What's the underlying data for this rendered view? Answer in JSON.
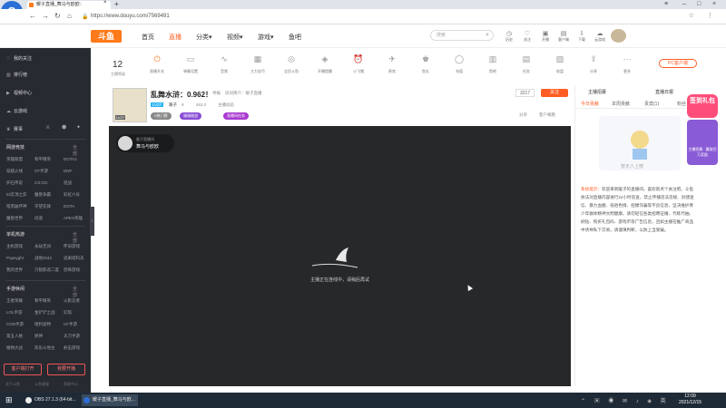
{
  "browser": {
    "tab_title": "暖子直播_舞马与欧欧：",
    "url": "https://www.douyu.com/7569491",
    "logo_letter": "S"
  },
  "header": {
    "brand": "斗鱼",
    "nav": [
      "首页",
      "直播",
      "分类",
      "视频",
      "游戏",
      "鱼吧"
    ],
    "search_placeholder": "搜索",
    "icons": [
      {
        "name": "history-icon",
        "label": "历史"
      },
      {
        "name": "follow-icon",
        "label": "关注"
      },
      {
        "name": "open-live-icon",
        "label": "开播"
      },
      {
        "name": "fish-bar-icon",
        "label": "客户端"
      },
      {
        "name": "download-icon",
        "label": "下载"
      },
      {
        "name": "cloud-icon",
        "label": "云游戏"
      },
      {
        "name": "mail-icon",
        "label": "任务中心"
      }
    ]
  },
  "sidebar": {
    "top_items": [
      {
        "icon": "heart-icon",
        "label": "我的关注"
      },
      {
        "icon": "rank-icon",
        "label": "排行榜"
      },
      {
        "icon": "video-icon",
        "label": "视频中心"
      },
      {
        "icon": "cloud-game-icon",
        "label": "云游戏"
      },
      {
        "icon": "match-icon",
        "label": "赛事"
      }
    ],
    "sections": [
      {
        "title": "网游竞技",
        "all": "全部",
        "items": [
          "英雄联盟",
          "和平精英",
          "DOTA2",
          "穿越火线",
          "CF手游",
          "DNF",
          "炉石传说",
          "CS:GO",
          "逆战",
          "lol云顶之弈",
          "魔兽争霸",
          "彩虹六号",
          "暗黑破坏神",
          "守望先锋",
          "DOTA",
          "魔兽世界",
          "问道",
          "APEX英雄"
        ]
      },
      {
        "title": "单机热游",
        "all": "全部",
        "items": [
          "主机游戏",
          "永劫无间",
          "怀旧游戏",
          "Popeyght",
          "战地2042",
          "逃离塔科夫",
          "我的世界",
          "只狼影逝二度",
          "恐怖游戏"
        ]
      },
      {
        "title": "手游休闲",
        "all": "全部",
        "items": [
          "王者荣耀",
          "和平精英",
          "火影忍者",
          "LOL手游",
          "金铲铲之战",
          "幻塔",
          "COD手游",
          "哈利波特",
          "CF手游",
          "第五人格",
          "原神",
          "天刀手游",
          "植物大战",
          "欢乐斗地主",
          "射击游戏"
        ]
      }
    ],
    "buttons": [
      "客户端打开",
      "我要开播"
    ],
    "footer": [
      "关于斗鱼",
      "斗鱼客服",
      "帮助中心"
    ]
  },
  "toolbar": {
    "level": "12",
    "level_label": "主播等级",
    "items": [
      "直播开关",
      "弹幕设置",
      "音频",
      "大力金币",
      "全民斗鱼",
      "开播提醒",
      "小飞猪",
      "贵宾",
      "鱼丸",
      "充值",
      "鱼吧",
      "任务",
      "轮盘",
      "分享",
      "更多"
    ],
    "pc_button": "PC客户端"
  },
  "room": {
    "title": "乱舞水浒：0.962！",
    "meta": [
      "举报",
      "房间简介：暖子直播"
    ],
    "anchor": "暖子",
    "level_tag": "LV27",
    "stats": [
      "9",
      "463.2",
      "主播动态"
    ],
    "tags": [
      "V热门榜",
      "福瑞燃战",
      "直播间任务"
    ],
    "follow_count": "3217",
    "follow_label": "关注",
    "actions": [
      "分享",
      "客户端看"
    ]
  },
  "player": {
    "anchor_line1": "暖子直播间",
    "anchor_line2": "舞马与欧欧",
    "loading_text": "主播正在连线中，请稍后再试"
  },
  "right_panel": {
    "top_tabs": [
      "主播招募",
      "直播日报"
    ],
    "tabs": [
      "今日贡献",
      "本周贡献",
      "贵宾(1)",
      "粉丝"
    ],
    "empty_text": "暂无人上榜",
    "sys_tag": "系统提示：",
    "sys_text": "欢迎来到暖子的直播间，喜欢就点个关注吧。斗鱼依法对直播内容进行24小时巡查，禁止传播违法违规、封建迷信、暴力血腥、低俗色情、招嫖诈骗等不良信息，坚决维护青少年群体精神文明健康。请勿轻信各类招聘征婚、代练代抽、刷钻、购买礼包码、游戏币等广告信息，且如主播在推广商品中诱导私下交易，请谨慎判断，以防上当受骗。"
  },
  "ads": {
    "ad1": "签到礼包",
    "ad2": "主播招募 · 赢取百万奖励"
  },
  "taskbar": {
    "items": [
      "OBS 27.1.3 (64-bit...",
      "暖子直播_舞马与欧..."
    ],
    "time": "12:09",
    "date": "2021/12/15"
  }
}
